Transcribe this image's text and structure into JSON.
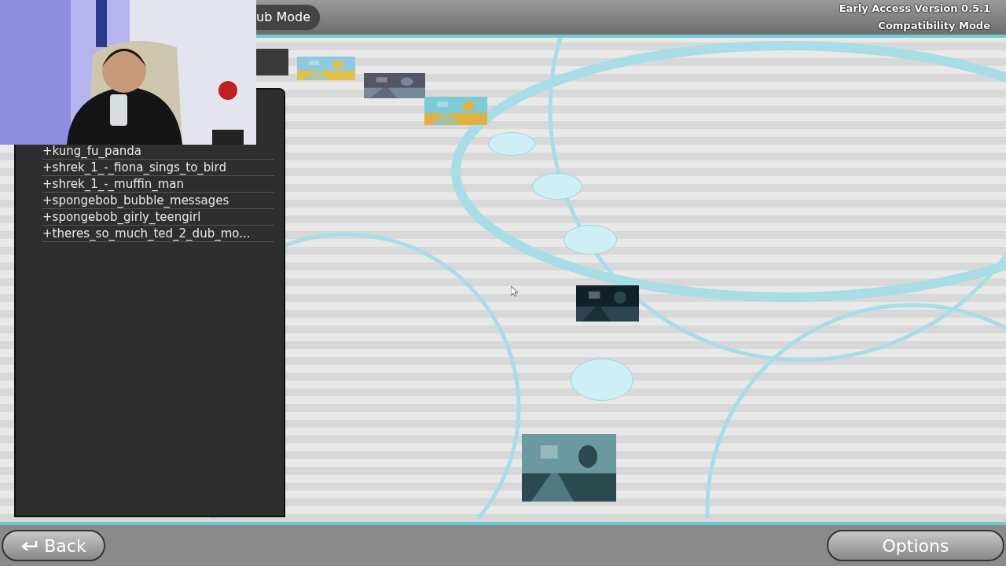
{
  "header": {
    "mode_title": "ub Mode",
    "version_lines": [
      "Early Access Version 0.5.1",
      "Compatibility Mode"
    ]
  },
  "webcam": {
    "kind": "picture"
  },
  "song_list": [
    {
      "label": "+kung_fu_panda"
    },
    {
      "label": "+shrek_1_-_fiona_sings_to_bird"
    },
    {
      "label": "+shrek_1_-_muffin_man"
    },
    {
      "label": "+spongebob_bubble_messages"
    },
    {
      "label": "+spongebob_girly_teengirl"
    },
    {
      "label": "+theres_so_much_ted_2_dub_mo..."
    }
  ],
  "track": [
    {
      "kind": "picture"
    },
    {
      "kind": "picture"
    },
    {
      "kind": "picture"
    },
    {
      "kind": "bubble"
    },
    {
      "kind": "bubble"
    },
    {
      "kind": "bubble"
    },
    {
      "kind": "picture"
    },
    {
      "kind": "bubble"
    },
    {
      "kind": "picture"
    }
  ],
  "buttons": {
    "back": "Back",
    "options": "Options"
  }
}
